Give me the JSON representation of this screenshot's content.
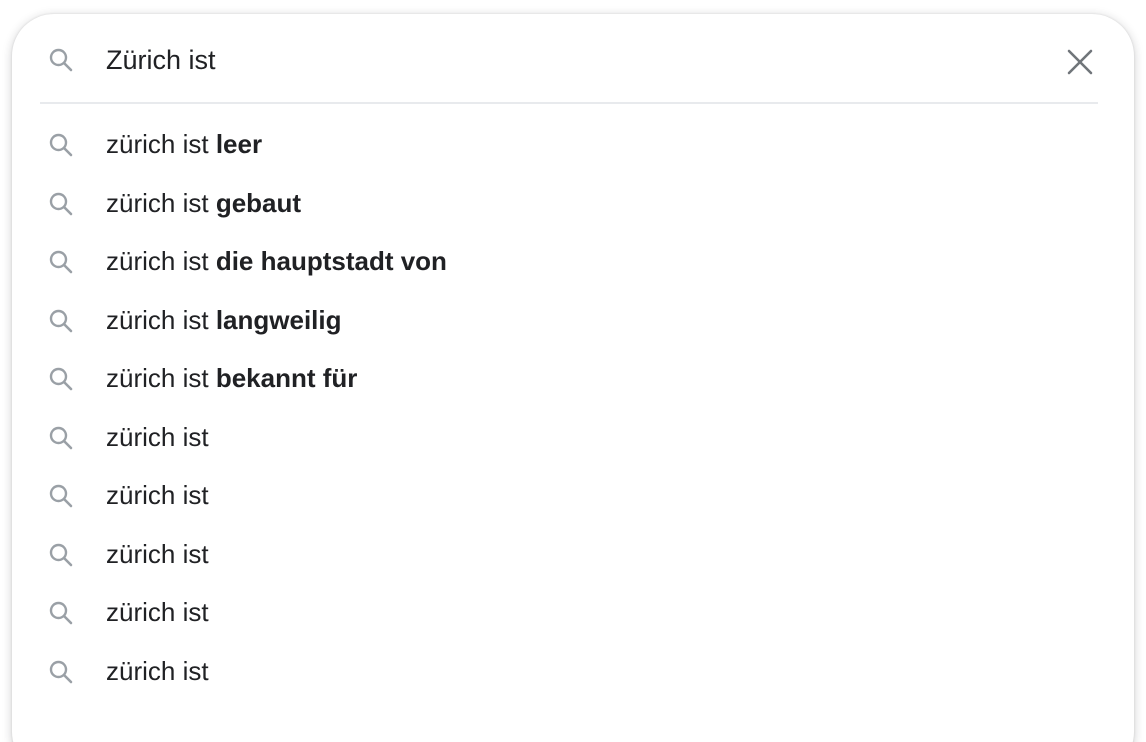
{
  "search": {
    "value": "Zürich ist",
    "search_icon": "search-icon",
    "clear_icon": "close-icon"
  },
  "colors": {
    "icon_gray": "#9aa0a6",
    "text": "#202124",
    "divider": "#e8eaed"
  },
  "suggestions": [
    {
      "prefix": "zürich ist ",
      "completion": "leer",
      "icon": "search-icon"
    },
    {
      "prefix": "zürich ist ",
      "completion": "gebaut",
      "icon": "search-icon"
    },
    {
      "prefix": "zürich ist ",
      "completion": "die hauptstadt von",
      "icon": "search-icon"
    },
    {
      "prefix": "zürich ist ",
      "completion": "langweilig",
      "icon": "search-icon"
    },
    {
      "prefix": "zürich ist ",
      "completion": "bekannt für",
      "icon": "search-icon"
    },
    {
      "prefix": "zürich ist",
      "completion": "",
      "icon": "search-icon"
    },
    {
      "prefix": "zürich ist",
      "completion": "",
      "icon": "search-icon"
    },
    {
      "prefix": "zürich ist",
      "completion": "",
      "icon": "search-icon"
    },
    {
      "prefix": "zürich ist",
      "completion": "",
      "icon": "search-icon"
    },
    {
      "prefix": "zürich ist",
      "completion": "",
      "icon": "search-icon"
    }
  ]
}
